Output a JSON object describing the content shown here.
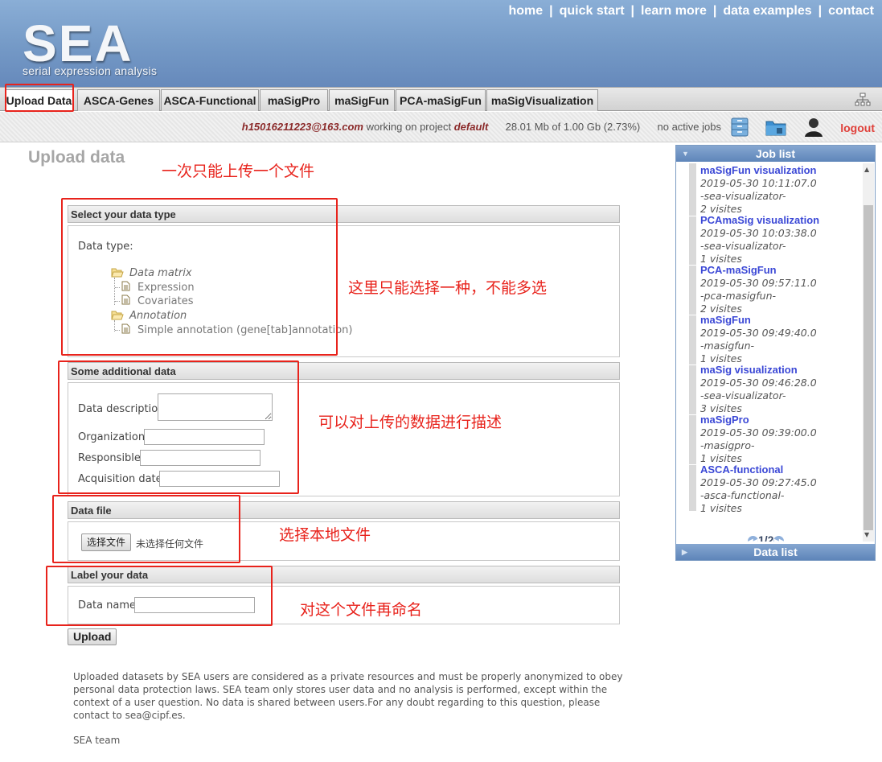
{
  "header": {
    "logo_main": "SEA",
    "logo_sub": "serial expression analysis",
    "nav": [
      "home",
      "quick start",
      "learn more",
      "data examples",
      "contact"
    ],
    "separator": "|"
  },
  "tabs": [
    "Upload Data",
    "ASCA-Genes",
    "ASCA-Functional",
    "maSigPro",
    "maSigFun",
    "PCA-maSigFun",
    "maSigVisualization"
  ],
  "status": {
    "user": "h15016211223@163.com",
    "working_text": "working on project",
    "project": "default",
    "quota": "28.01 Mb of 1.00 Gb (2.73%)",
    "jobs": "no active jobs",
    "logout": "logout"
  },
  "page": {
    "title": "Upload data",
    "upload_button": "Upload",
    "disclaimer": "Uploaded datasets by SEA users are considered as a private resources and must be properly anonymized to obey personal data protection laws. SEA team only stores user data and no analysis is performed, except within the context of a user question. No data is shared between users.For any doubt regarding to this question, please contact to sea@cipf.es.",
    "signoff": "SEA team"
  },
  "section_type": {
    "header": "Select your data type",
    "label": "Data type:",
    "tree": {
      "folder1": "Data matrix",
      "leaf1": "Expression",
      "leaf2": "Covariates",
      "folder2": "Annotation",
      "leaf3": "Simple annotation (gene[tab]annotation)"
    }
  },
  "section_additional": {
    "header": "Some additional data",
    "description_label": "Data description",
    "organization_label": "Organization:",
    "responsible_label": "Responsible:",
    "acquisition_label": "Acquisition date:"
  },
  "section_file": {
    "header": "Data file",
    "choose_button": "选择文件",
    "no_file": "未选择任何文件"
  },
  "section_label": {
    "header": "Label your data",
    "name_label": "Data name:"
  },
  "annotations": {
    "a1": "一次只能上传一个文件",
    "a2": "这里只能选择一种，不能多选",
    "a3": "可以对上传的数据进行描述",
    "a4": "选择本地文件",
    "a5": "对这个文件再命名"
  },
  "joblist": {
    "title": "Job list",
    "datalist_title": "Data list",
    "pager": "1/2",
    "jobs": [
      {
        "name": "maSigFun visualization",
        "date": "2019-05-30 10:11:07.0",
        "tag": "-sea-visualizator-",
        "visits": "2 visites"
      },
      {
        "name": "PCAmaSig visualization",
        "date": "2019-05-30 10:03:38.0",
        "tag": "-sea-visualizator-",
        "visits": "1 visites"
      },
      {
        "name": "PCA-maSigFun",
        "date": "2019-05-30 09:57:11.0",
        "tag": "-pca-masigfun-",
        "visits": "2 visites"
      },
      {
        "name": "maSigFun",
        "date": "2019-05-30 09:49:40.0",
        "tag": "-masigfun-",
        "visits": "1 visites"
      },
      {
        "name": "maSig visualization",
        "date": "2019-05-30 09:46:28.0",
        "tag": "-sea-visualizator-",
        "visits": "3 visites"
      },
      {
        "name": "maSigPro",
        "date": "2019-05-30 09:39:00.0",
        "tag": "-masigpro-",
        "visits": "1 visites"
      },
      {
        "name": "ASCA-functional",
        "date": "2019-05-30 09:27:45.0",
        "tag": "-asca-functional-",
        "visits": "1 visites"
      }
    ]
  }
}
